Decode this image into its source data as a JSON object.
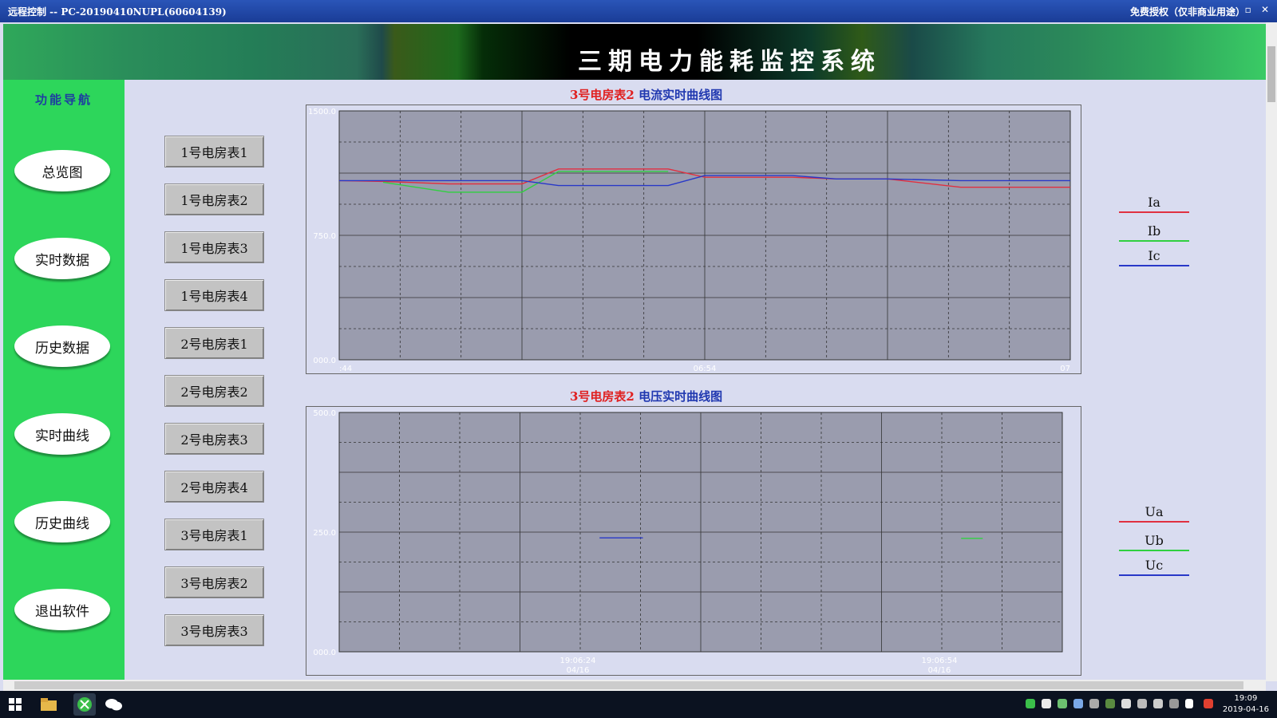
{
  "window": {
    "title": "远程控制 -- PC-20190410NUPL(60604139)",
    "license": "免费授权（仅非商业用途）",
    "controls": "– ▫ ✕"
  },
  "header": {
    "title": "三期电力能耗监控系统"
  },
  "sidebar": {
    "title": "功能导航",
    "items": [
      {
        "label": "总览图"
      },
      {
        "label": "实时数据"
      },
      {
        "label": "历史数据"
      },
      {
        "label": "实时曲线"
      },
      {
        "label": "历史曲线"
      },
      {
        "label": "退出软件"
      }
    ]
  },
  "meters": [
    {
      "label": "1号电房表1"
    },
    {
      "label": "1号电房表2"
    },
    {
      "label": "1号电房表3"
    },
    {
      "label": "1号电房表4"
    },
    {
      "label": "2号电房表1"
    },
    {
      "label": "2号电房表2"
    },
    {
      "label": "2号电房表3"
    },
    {
      "label": "2号电房表4"
    },
    {
      "label": "3号电房表1"
    },
    {
      "label": "3号电房表2"
    },
    {
      "label": "3号电房表3"
    }
  ],
  "colors": {
    "red": "#e03040",
    "green": "#30d040",
    "blue": "#2838c8"
  },
  "chart_data": [
    {
      "type": "line",
      "title_part1": "3号电房表2",
      "title_part2": " 电流实时曲线图",
      "ylim": [
        0,
        1500
      ],
      "yticks": [
        "1500.0",
        "750.0",
        "000.0"
      ],
      "xticks": [
        ":44",
        "06:54",
        "07"
      ],
      "legend_position": "right",
      "x": [
        0,
        0.06,
        0.15,
        0.25,
        0.3,
        0.45,
        0.5,
        0.62,
        0.68,
        0.75,
        0.85,
        0.93,
        1.0
      ],
      "series": [
        {
          "name": "Ia",
          "color": "#e03040",
          "values": [
            1080,
            1075,
            1060,
            1060,
            1150,
            1150,
            1100,
            1100,
            1090,
            1090,
            1040,
            1040,
            1040
          ]
        },
        {
          "name": "Ib",
          "color": "#30d040",
          "values": [
            null,
            1070,
            1010,
            1010,
            1135,
            1135,
            null,
            1030,
            null,
            null,
            1030,
            null,
            null
          ]
        },
        {
          "name": "Ic",
          "color": "#2838c8",
          "values": [
            1080,
            1080,
            1080,
            1080,
            1050,
            1050,
            1110,
            1110,
            1090,
            1090,
            1080,
            1080,
            1080
          ]
        }
      ]
    },
    {
      "type": "line",
      "title_part1": "3号电房表2",
      "title_part2": " 电压实时曲线图",
      "ylim": [
        0,
        500
      ],
      "yticks": [
        "500.0",
        "250.0",
        "000.0"
      ],
      "xticks": [
        {
          "time": "19:06:24",
          "date": "04/16"
        },
        {
          "time": "19:06:54",
          "date": "04/16"
        }
      ],
      "legend_position": "right",
      "x": [
        0.36,
        0.42,
        0.86,
        0.89
      ],
      "series": [
        {
          "name": "Ua",
          "color": "#e03040",
          "values": [
            null,
            null,
            null,
            null
          ]
        },
        {
          "name": "Ub",
          "color": "#30d040",
          "values": [
            null,
            null,
            237,
            237
          ]
        },
        {
          "name": "Uc",
          "color": "#2838c8",
          "values": [
            238,
            238,
            null,
            null
          ]
        }
      ]
    }
  ],
  "taskbar": {
    "time": "19:09",
    "date": "2019-04-16"
  }
}
